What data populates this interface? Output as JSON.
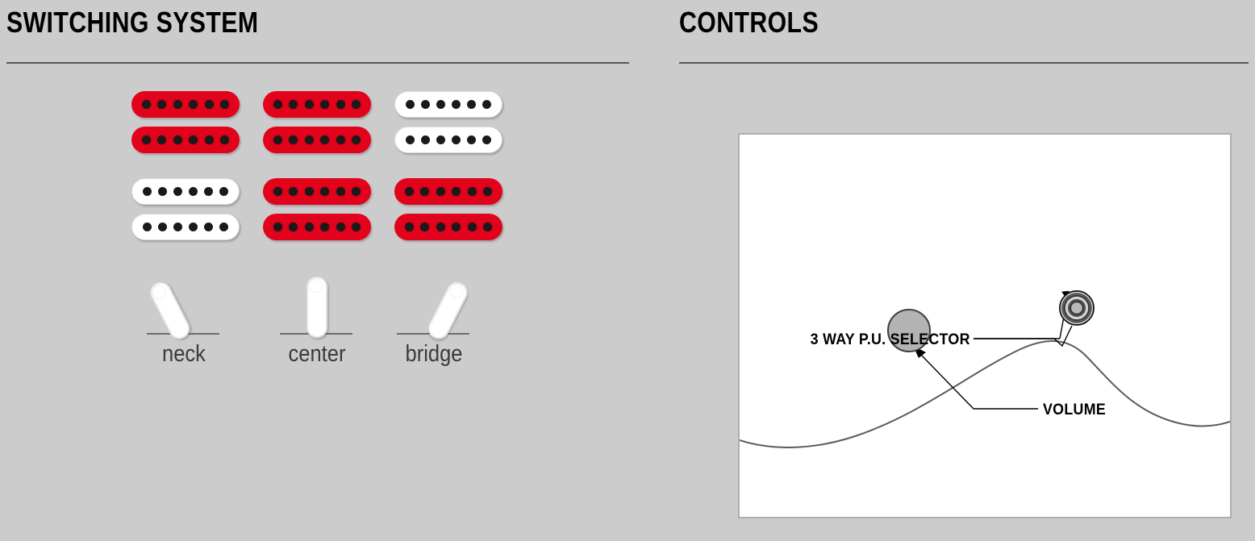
{
  "page": {
    "background_color": "#cccccc"
  },
  "sections": {
    "switching": {
      "title": "SWITCHING SYSTEM",
      "pickup_grid": {
        "rows": [
          {
            "row_label": "humbucker-row-top",
            "pickups": [
              {
                "position": "neck",
                "color": "red",
                "color_hex": "#e3021b",
                "poles": 6
              },
              {
                "position": "center",
                "color": "red",
                "color_hex": "#e3021b",
                "poles": 6
              },
              {
                "position": "bridge",
                "color": "white",
                "color_hex": "#ffffff",
                "poles": 6
              }
            ]
          },
          {
            "row_label": "humbucker-row-bottom",
            "pickups": [
              {
                "position": "neck",
                "color": "white",
                "color_hex": "#ffffff",
                "poles": 6
              },
              {
                "position": "center",
                "color": "red",
                "color_hex": "#e3021b",
                "poles": 6
              },
              {
                "position": "bridge",
                "color": "red",
                "color_hex": "#e3021b",
                "poles": 6
              }
            ]
          }
        ]
      },
      "switches": [
        {
          "label": "neck",
          "lever_tilt": "left"
        },
        {
          "label": "center",
          "lever_tilt": "none"
        },
        {
          "label": "bridge",
          "lever_tilt": "right"
        }
      ]
    },
    "controls": {
      "title": "CONTROLS",
      "callouts": [
        {
          "label": "3 WAY P.U. SELECTOR",
          "target": "selector-knob"
        },
        {
          "label": "VOLUME",
          "target": "volume-knob"
        }
      ],
      "knobs": [
        {
          "name": "volume-knob",
          "type": "plain",
          "fill": "#b3b3b3"
        },
        {
          "name": "selector-knob",
          "type": "concentric",
          "fill": "#555555"
        }
      ]
    }
  }
}
